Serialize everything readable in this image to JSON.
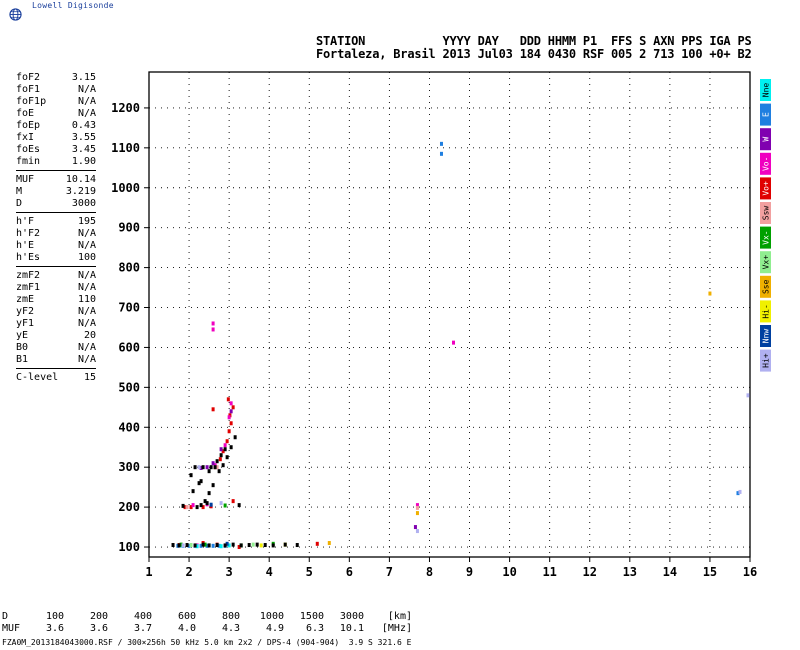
{
  "brand": {
    "name": "Lowell Digisonde",
    "icon": "globe-icon"
  },
  "header": {
    "line1": "STATION           YYYY DAY   DDD HHMM P1  FFS S AXN PPS IGA PS",
    "line2": "Fortaleza, Brasil 2013 Jul03 184 0430 RSF 005 2 713 100 +0+ B2"
  },
  "scaled_parameters": [
    {
      "name": "foF2",
      "value": "3.15"
    },
    {
      "name": "foF1",
      "value": "N/A"
    },
    {
      "name": "foF1p",
      "value": "N/A"
    },
    {
      "name": "foE",
      "value": "N/A"
    },
    {
      "name": "foEp",
      "value": "0.43"
    },
    {
      "name": "fxI",
      "value": "3.55"
    },
    {
      "name": "foEs",
      "value": "3.45"
    },
    {
      "name": "fmin",
      "value": "1.90"
    },
    {
      "name": "MUF",
      "value": "10.14"
    },
    {
      "name": "M",
      "value": "3.219"
    },
    {
      "name": "D",
      "value": "3000"
    },
    {
      "name": "h'F",
      "value": "195"
    },
    {
      "name": "h'F2",
      "value": "N/A"
    },
    {
      "name": "h'E",
      "value": "N/A"
    },
    {
      "name": "h'Es",
      "value": "100"
    },
    {
      "name": "zmF2",
      "value": "N/A"
    },
    {
      "name": "zmF1",
      "value": "N/A"
    },
    {
      "name": "zmE",
      "value": "110"
    },
    {
      "name": "yF2",
      "value": "N/A"
    },
    {
      "name": "yF1",
      "value": "N/A"
    },
    {
      "name": "yE",
      "value": "20"
    },
    {
      "name": "B0",
      "value": "N/A"
    },
    {
      "name": "B1",
      "value": "N/A"
    },
    {
      "name": "C-level",
      "value": "15"
    }
  ],
  "legend": [
    {
      "label": "Nne",
      "color": "#00f0f0"
    },
    {
      "label": "E",
      "color": "#1f7fe0"
    },
    {
      "label": "W",
      "color": "#8000b0"
    },
    {
      "label": "Vo-",
      "color": "#f000c0"
    },
    {
      "label": "Vo+",
      "color": "#e00000"
    },
    {
      "label": "Ssw",
      "color": "#f2a0a0"
    },
    {
      "label": "Vx-",
      "color": "#00a000"
    },
    {
      "label": "Vx+",
      "color": "#90ee90"
    },
    {
      "label": "Sse",
      "color": "#f0b000"
    },
    {
      "label": "Hi-",
      "color": "#f0f000"
    },
    {
      "label": "Nnw",
      "color": "#0040a0"
    },
    {
      "label": "Hi+",
      "color": "#b0b0f0"
    }
  ],
  "bottom_table": {
    "rows": [
      {
        "label": "D",
        "values": [
          "100",
          "200",
          "400",
          "600",
          "800",
          "1000",
          "1500",
          "3000"
        ],
        "unit": "[km]"
      },
      {
        "label": "MUF",
        "values": [
          "3.6",
          "3.6",
          "3.7",
          "4.0",
          "4.3",
          "4.9",
          "6.3",
          "10.1"
        ],
        "unit": "[MHz]"
      }
    ]
  },
  "footer": "FZA0M_2013184043000.RSF / 300×256h 50 kHz 5.0 km 2x2 / DPS-4 (904-904)  3.9 S 321.6 E",
  "chart_data": {
    "type": "scatter",
    "title": "",
    "xlabel": "",
    "ylabel": "",
    "xlim": [
      1,
      16
    ],
    "ylim": [
      75,
      1290
    ],
    "x_ticks": [
      1,
      2,
      3,
      4,
      5,
      6,
      7,
      8,
      9,
      10,
      11,
      12,
      13,
      14,
      15,
      16
    ],
    "y_ticks": [
      100,
      200,
      300,
      400,
      500,
      600,
      700,
      800,
      900,
      1000,
      1100,
      1200
    ],
    "grid": true,
    "series": [
      {
        "name": "Vo+",
        "color": "#e00000",
        "x": [
          1.9,
          2.05,
          2.35,
          2.55,
          2.65,
          2.78,
          2.85,
          2.95,
          3.0,
          3.05,
          3.1,
          2.6,
          2.35,
          2.7,
          2.98,
          3.02,
          3.1,
          3.25,
          5.2,
          1.75
        ],
        "y": [
          200,
          200,
          200,
          202,
          300,
          320,
          340,
          365,
          390,
          410,
          450,
          445,
          110,
          106,
          470,
          430,
          215,
          100,
          108,
          105
        ]
      },
      {
        "name": "Vo-",
        "color": "#f000c0",
        "x": [
          2.65,
          2.9,
          3.0,
          3.05,
          2.1,
          7.7,
          2.6,
          2.6,
          8.6,
          2.2,
          2.45
        ],
        "y": [
          305,
          355,
          425,
          460,
          205,
          205,
          660,
          645,
          612,
          104,
          207
        ]
      },
      {
        "name": "E",
        "color": "#1f7fe0",
        "x": [
          1.72,
          1.85,
          2.0,
          2.15,
          2.3,
          2.45,
          2.6,
          2.75,
          2.9,
          8.3,
          8.3,
          15.7
        ],
        "y": [
          103,
          103,
          103,
          103,
          103,
          103,
          103,
          103,
          103,
          1110,
          1085,
          235
        ]
      },
      {
        "name": "Nne",
        "color": "#00f0f0",
        "x": [
          1.8,
          2.2,
          2.5,
          2.8,
          3.0
        ],
        "y": [
          104,
          102,
          104,
          102,
          104
        ]
      },
      {
        "name": "W",
        "color": "#8000b0",
        "x": [
          2.45,
          2.6,
          2.8,
          3.05,
          2.3,
          7.65
        ],
        "y": [
          300,
          310,
          345,
          440,
          298,
          150
        ]
      },
      {
        "name": "Vx-",
        "color": "#00a000",
        "x": [
          1.8,
          3.3,
          4.1,
          2.9,
          2.4
        ],
        "y": [
          106,
          104,
          108,
          204,
          106
        ]
      },
      {
        "name": "Hi+",
        "color": "#b0b0f0",
        "x": [
          1.85,
          2.25,
          2.8,
          7.7,
          15.75,
          15.95
        ],
        "y": [
          104,
          300,
          210,
          140,
          238,
          480
        ]
      },
      {
        "name": "Sse",
        "color": "#f0b000",
        "x": [
          5.5,
          7.7,
          15.0
        ],
        "y": [
          110,
          185,
          735
        ]
      },
      {
        "name": "Ssw",
        "color": "#f2a0a0",
        "x": [
          1.95,
          2.7,
          7.7
        ],
        "y": [
          200,
          300,
          198
        ]
      },
      {
        "name": "Nnw",
        "color": "#0040a0",
        "x": [
          2.55,
          2.95
        ],
        "y": [
          206,
          108
        ]
      },
      {
        "name": "Hi-",
        "color": "#f0f000",
        "x": [
          3.8,
          4.4
        ],
        "y": [
          104,
          106
        ]
      },
      {
        "name": "Vx+",
        "color": "#90ee90",
        "x": [
          2.05,
          3.6
        ],
        "y": [
          105,
          106
        ]
      },
      {
        "name": "",
        "color": "#000000",
        "x": [
          1.6,
          1.75,
          1.95,
          2.15,
          2.35,
          2.5,
          2.7,
          2.9,
          3.1,
          3.3,
          3.5,
          3.7,
          3.9,
          4.1,
          4.4,
          4.7,
          2.2,
          2.3,
          2.4,
          2.5,
          2.6,
          2.75,
          2.85,
          2.95,
          3.05,
          3.15,
          3.25,
          2.1,
          2.3,
          2.5,
          2.7,
          2.8,
          2.9,
          1.85,
          2.15,
          2.35,
          2.55,
          2.45,
          2.65,
          2.05,
          2.25
        ],
        "y": [
          105,
          104,
          105,
          104,
          106,
          104,
          105,
          104,
          106,
          104,
          105,
          106,
          105,
          104,
          106,
          105,
          200,
          205,
          215,
          235,
          255,
          290,
          305,
          325,
          350,
          375,
          205,
          240,
          265,
          290,
          315,
          330,
          345,
          203,
          300,
          300,
          300,
          210,
          300,
          280,
          260
        ]
      }
    ]
  }
}
